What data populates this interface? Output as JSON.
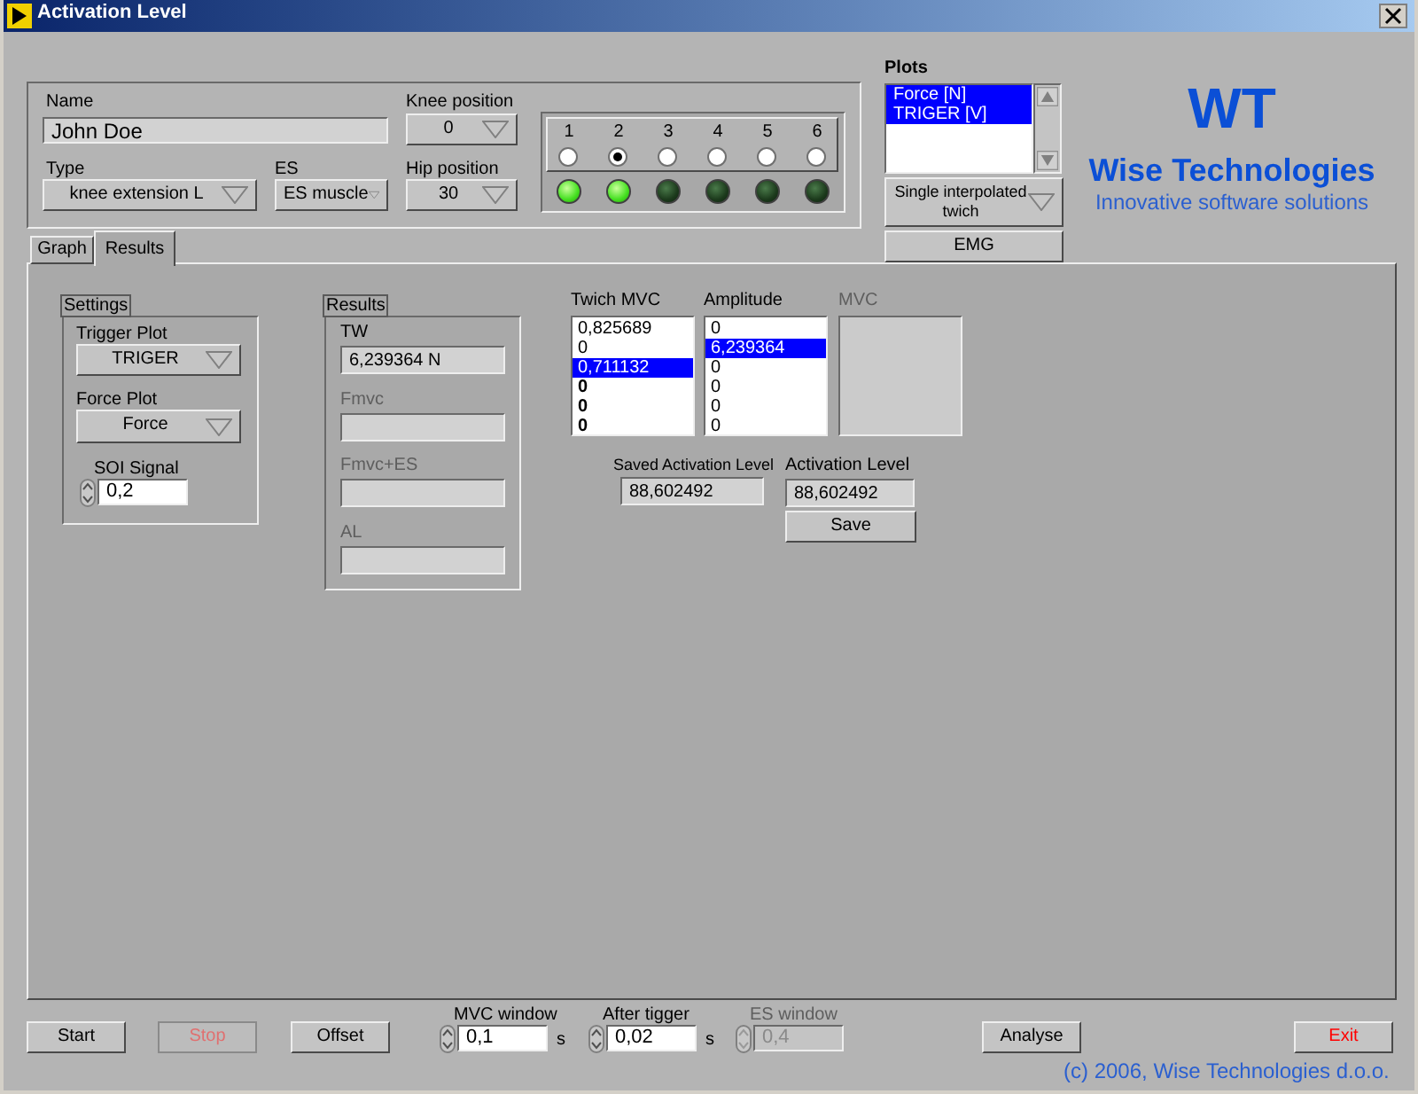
{
  "window": {
    "title": "Activation Level"
  },
  "subject": {
    "name": {
      "label": "Name",
      "value": "John Doe"
    },
    "knee_position": {
      "label": "Knee position",
      "value": "0"
    },
    "type": {
      "label": "Type",
      "value": "knee extension L"
    },
    "es": {
      "label": "ES",
      "value": "ES muscle"
    },
    "hip_position": {
      "label": "Hip position",
      "value": "30"
    }
  },
  "channels": [
    {
      "label": "1",
      "selected": false,
      "on": true
    },
    {
      "label": "2",
      "selected": true,
      "on": true
    },
    {
      "label": "3",
      "selected": false,
      "on": false
    },
    {
      "label": "4",
      "selected": false,
      "on": false
    },
    {
      "label": "5",
      "selected": false,
      "on": false
    },
    {
      "label": "6",
      "selected": false,
      "on": false
    }
  ],
  "plots": {
    "label": "Plots",
    "items": [
      {
        "label": "Force [N]",
        "selected": true
      },
      {
        "label": "TRIGER [V]",
        "selected": true
      }
    ]
  },
  "mode": {
    "value": "Single interpolated twich"
  },
  "emg_button": {
    "label": "EMG"
  },
  "logo": {
    "mark": "WT",
    "name": "Wise Technologies",
    "tagline": "Innovative software solutions"
  },
  "tabs": [
    {
      "label": "Graph",
      "selected": false
    },
    {
      "label": "Results",
      "selected": true
    }
  ],
  "settings": {
    "title": "Settings",
    "trigger_plot": {
      "label": "Trigger Plot",
      "value": "TRIGER"
    },
    "force_plot": {
      "label": "Force Plot",
      "value": "Force"
    },
    "soi_signal": {
      "label": "SOI Signal",
      "value": "0,2"
    }
  },
  "results": {
    "title": "Results",
    "fields": [
      {
        "label": "TW",
        "value": "6,239364 N",
        "disabled": false
      },
      {
        "label": "Fmvc",
        "disabled": true
      },
      {
        "label": "Fmvc+ES",
        "disabled": true
      },
      {
        "label": "AL",
        "disabled": true
      }
    ]
  },
  "twich_mvc": {
    "label": "Twich MVC",
    "items": [
      {
        "text": "0,825689",
        "selected": false,
        "bold": false
      },
      {
        "text": "0",
        "selected": false,
        "bold": false
      },
      {
        "text": "0,711132",
        "selected": true,
        "bold": false
      },
      {
        "text": "0",
        "selected": false,
        "bold": true
      },
      {
        "text": "0",
        "selected": false,
        "bold": true
      },
      {
        "text": "0",
        "selected": false,
        "bold": true
      }
    ]
  },
  "amplitude": {
    "label": "Amplitude",
    "items": [
      {
        "text": "0",
        "selected": false,
        "bold": false
      },
      {
        "text": "6,239364",
        "selected": true,
        "bold": false
      },
      {
        "text": "0",
        "selected": false,
        "bold": false
      },
      {
        "text": "0",
        "selected": false,
        "bold": false
      },
      {
        "text": "0",
        "selected": false,
        "bold": false
      },
      {
        "text": "0",
        "selected": false,
        "bold": false
      }
    ]
  },
  "mvc": {
    "label": "MVC",
    "disabled": true
  },
  "saved_activation_level": {
    "label": "Saved Activation Level",
    "value": "88,602492"
  },
  "activation_level": {
    "label": "Activation Level",
    "value": "88,602492"
  },
  "save_button": {
    "label": "Save"
  },
  "buttons": [
    {
      "label": "Start",
      "disabled": false
    },
    {
      "label": "Stop",
      "disabled": true
    },
    {
      "label": "Offset",
      "disabled": false
    }
  ],
  "windows": [
    {
      "label": "MVC window",
      "value": "0,1",
      "unit": "s",
      "disabled": false
    },
    {
      "label": "After tigger",
      "value": "0,02",
      "unit": "s",
      "disabled": false
    },
    {
      "label": "ES window",
      "value": "0,4",
      "disabled": true
    }
  ],
  "analyse_button": {
    "label": "Analyse"
  },
  "exit_button": {
    "label": "Exit"
  },
  "copyright": "(c) 2006, Wise Technologies d.o.o."
}
